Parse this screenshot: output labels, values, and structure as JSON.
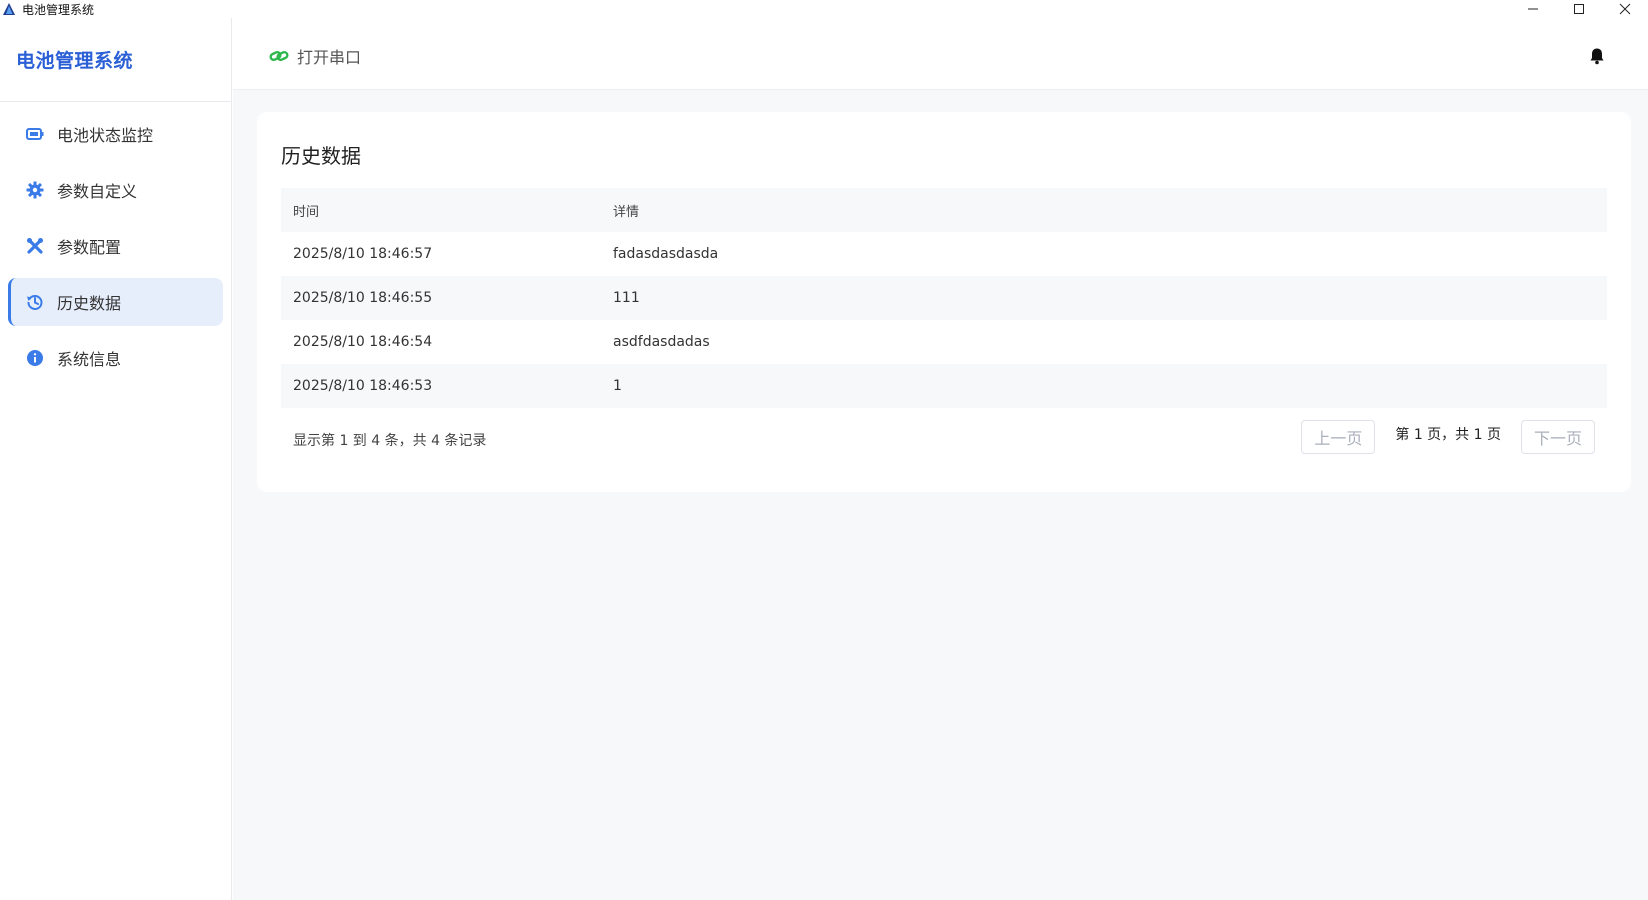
{
  "window": {
    "title": "电池管理系统"
  },
  "sidebar": {
    "brand": "电池管理系统",
    "items": [
      {
        "label": "电池状态监控",
        "icon": "battery-icon"
      },
      {
        "label": "参数自定义",
        "icon": "gear-icon"
      },
      {
        "label": "参数配置",
        "icon": "tools-icon"
      },
      {
        "label": "历史数据",
        "icon": "history-icon",
        "active": true
      },
      {
        "label": "系统信息",
        "icon": "info-icon"
      }
    ]
  },
  "header": {
    "open_port_label": "打开串口"
  },
  "card": {
    "title": "历史数据",
    "columns": {
      "time": "时间",
      "detail": "详情"
    },
    "rows": [
      {
        "time": "2025/8/10 18:46:57",
        "detail": "fadasdasdasda"
      },
      {
        "time": "2025/8/10 18:46:55",
        "detail": "111"
      },
      {
        "time": "2025/8/10 18:46:54",
        "detail": "asdfdasdadas"
      },
      {
        "time": "2025/8/10 18:46:53",
        "detail": "1"
      }
    ],
    "summary": "显示第 1 到 4 条，共 4 条记录",
    "pager": {
      "prev": "上一页",
      "info": "第 1 页，共 1 页",
      "next": "下一页"
    }
  },
  "colors": {
    "brand": "#2a5fd6",
    "accent": "#3a7be8",
    "link": "#2db84d",
    "active_bg": "#e6eefc"
  }
}
